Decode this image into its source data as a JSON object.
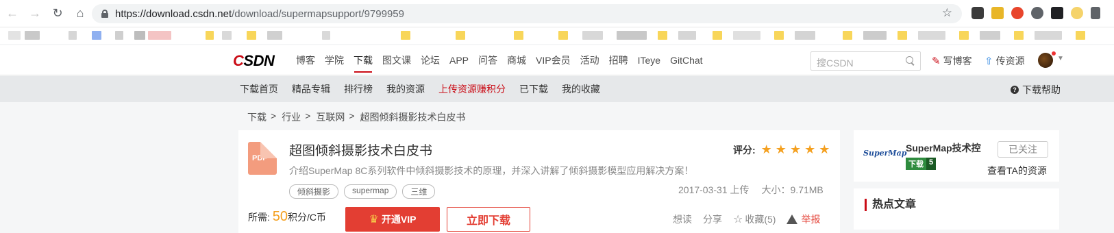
{
  "browser": {
    "url_host": "https://download.csdn.net",
    "url_path": "/download/supermapsupport/9799959"
  },
  "site": {
    "logo_c": "C",
    "logo_rest": "SDN",
    "nav": [
      "博客",
      "学院",
      "下载",
      "图文课",
      "论坛",
      "APP",
      "问答",
      "商城",
      "VIP会员",
      "活动",
      "招聘",
      "ITeye",
      "GitChat"
    ],
    "active_nav": "下载",
    "search_placeholder": "搜CSDN",
    "write_blog": "写博客",
    "upload": "传资源"
  },
  "sub_nav": {
    "items": [
      "下载首页",
      "精品专辑",
      "排行榜",
      "我的资源",
      "上传资源赚积分",
      "已下载",
      "我的收藏"
    ],
    "help": "下载帮助"
  },
  "breadcrumb": [
    "下载",
    "行业",
    "互联网",
    "超图倾斜摄影技术白皮书"
  ],
  "resource": {
    "file_type": "PDF",
    "title": "超图倾斜摄影技术白皮书",
    "rating_label": "评分:",
    "rating_stars": 5,
    "description": "介绍SuperMap 8C系列软件中倾斜摄影技术的原理，并深入讲解了倾斜摄影模型应用解决方案！",
    "tags": [
      "倾斜摄影",
      "supermap",
      "三维"
    ],
    "upload_info": "2017-03-31 上传",
    "size": "大小：9.71MB",
    "cost_prefix": "所需:",
    "cost_value": "50",
    "cost_suffix": "积分/C币",
    "vip_button": "开通VIP",
    "download_button": "立即下载",
    "actions": {
      "want": "想读",
      "share": "分享",
      "favorite": "收藏(5)",
      "report": "举报"
    }
  },
  "author_card": {
    "logo_text": "SuperMap",
    "name": "SuperMap技术控",
    "level_label": "下载",
    "level_num": "5",
    "follow_button": "已关注",
    "view_resources": "查看TA的资源"
  },
  "hot": {
    "title": "热点文章"
  },
  "colors": {
    "brand_red": "#ca0c16",
    "star": "#f4a020",
    "pdf": "#f39c7e"
  }
}
